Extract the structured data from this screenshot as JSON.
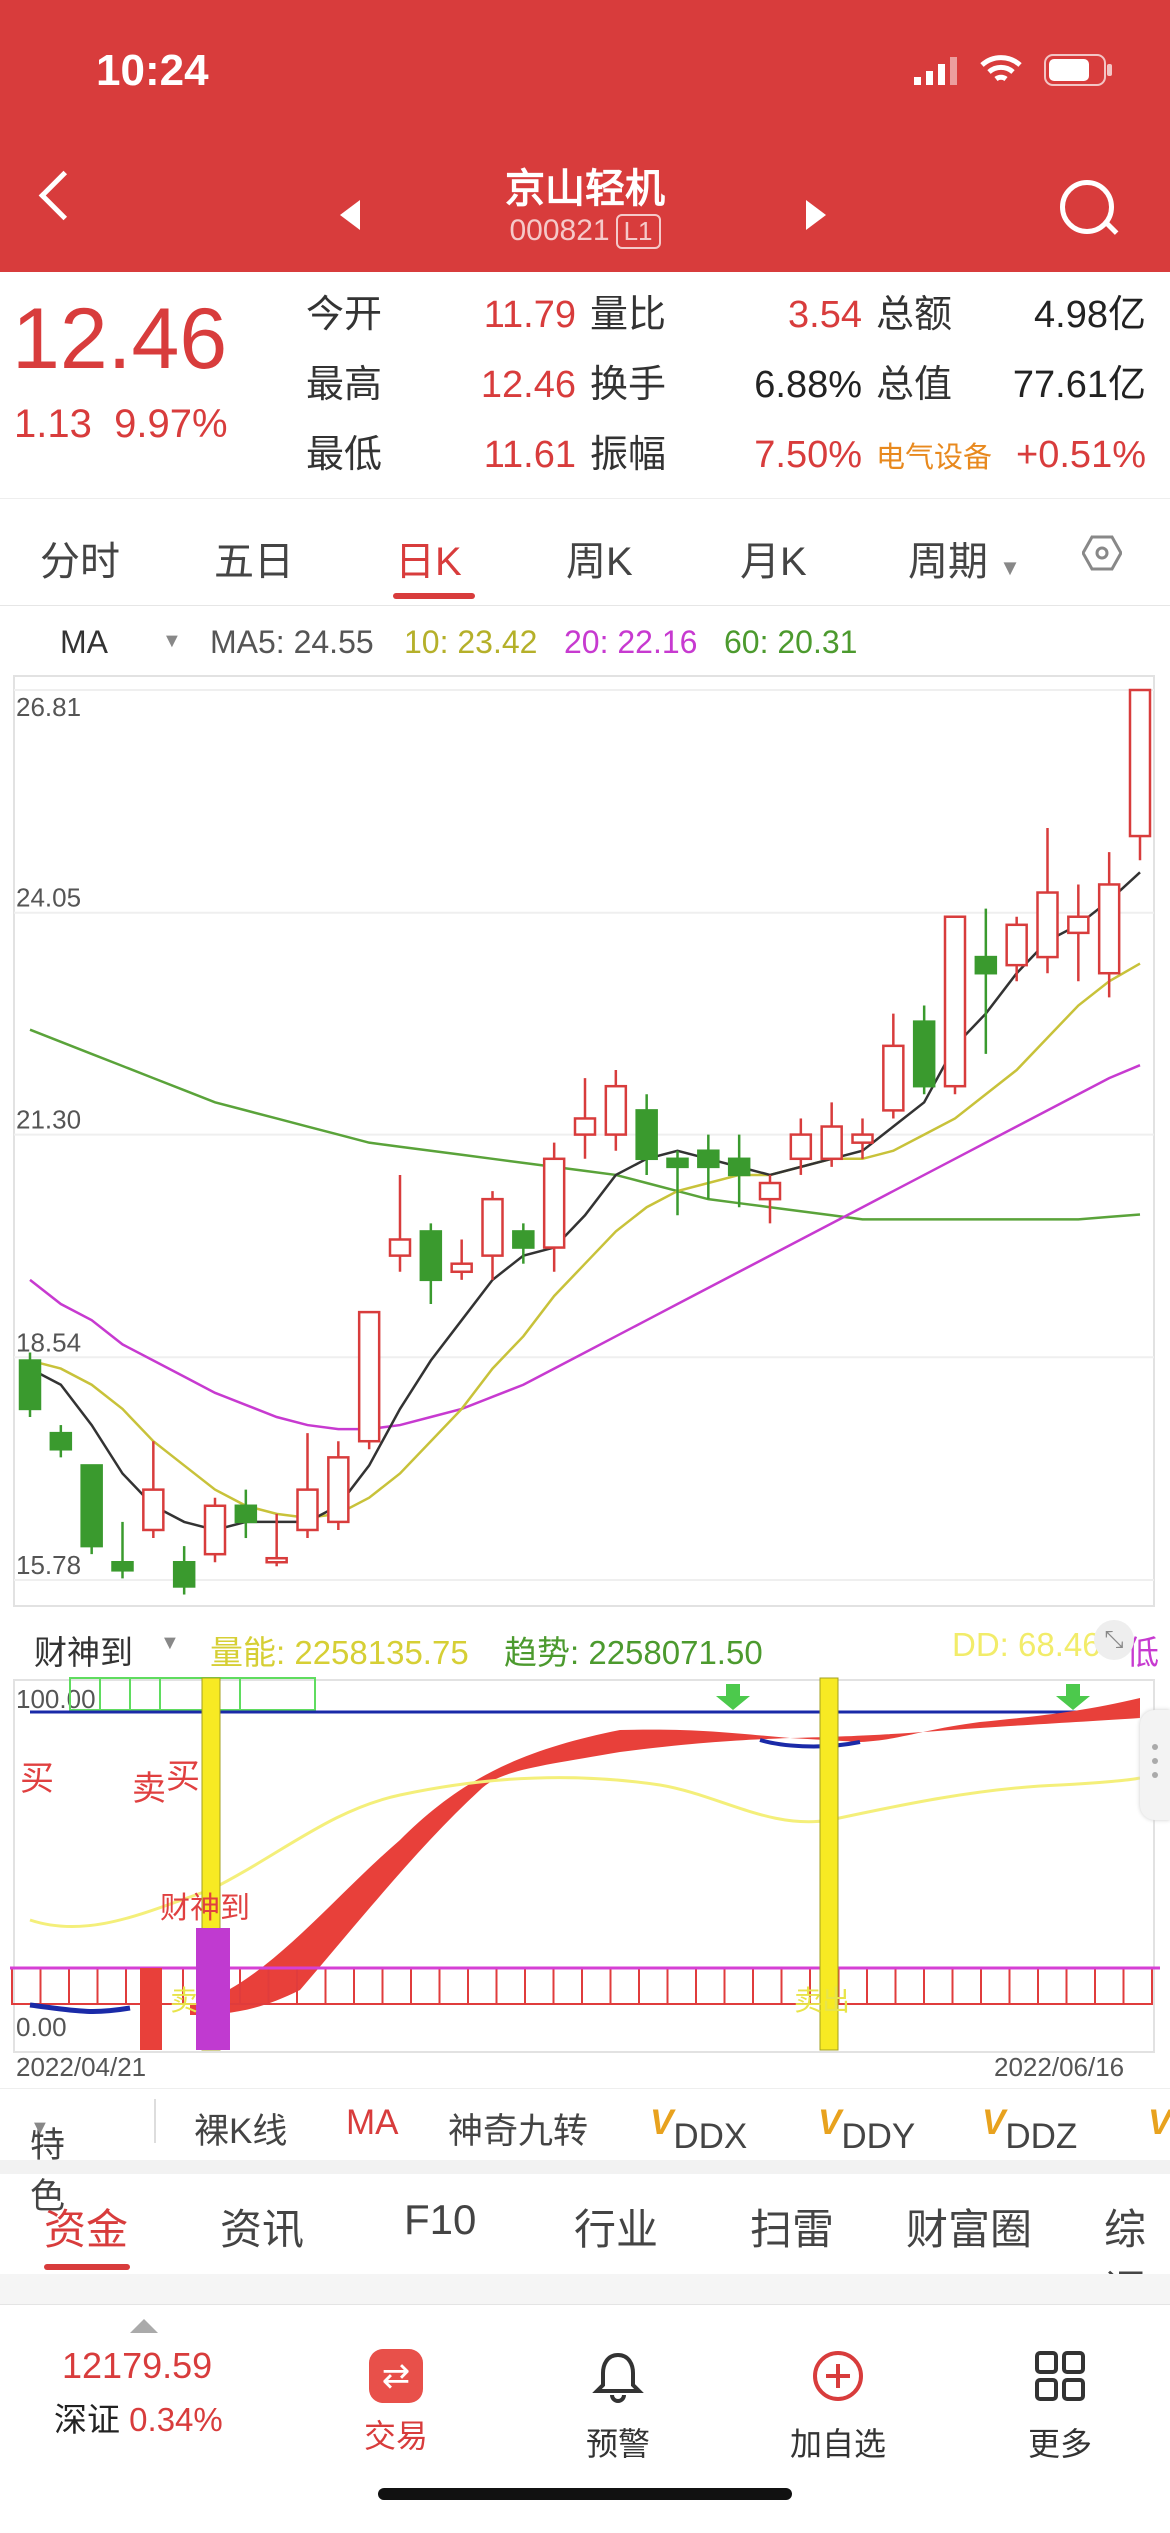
{
  "status": {
    "time": "10:24"
  },
  "header": {
    "title": "京山轻机",
    "code": "000821",
    "badge": "L1"
  },
  "quote": {
    "price": "12.46",
    "change": "1.13",
    "change_pct": "9.97%",
    "col1": [
      {
        "label": "今开",
        "value": "11.79"
      },
      {
        "label": "最高",
        "value": "12.46"
      },
      {
        "label": "最低",
        "value": "11.61"
      }
    ],
    "col2": [
      {
        "label": "量比",
        "value": "3.54"
      },
      {
        "label": "换手",
        "value": "6.88%"
      },
      {
        "label": "振幅",
        "value": "7.50%"
      }
    ],
    "col3": [
      {
        "label": "总额",
        "value": "4.98亿"
      },
      {
        "label": "总值",
        "value": "77.61亿"
      },
      {
        "label": "电气设备",
        "value": "+0.51%"
      }
    ]
  },
  "tabs": [
    "分时",
    "五日",
    "日K",
    "周K",
    "月K",
    "周期"
  ],
  "ma": {
    "name": "MA",
    "ma5": "MA5: 24.55",
    "ma10": "10: 23.42",
    "ma20": "20: 22.16",
    "ma60": "60: 20.31"
  },
  "indicator": {
    "name": "财神到",
    "vol": "量能: 2258135.75",
    "trend": "趋势: 2258071.50",
    "dd": "DD: 68.46",
    "extra": "低",
    "top_label": "100.00",
    "bottom_label": "0.00",
    "signal": "财神到",
    "left_text1": "买",
    "left_text2": "买",
    "left_text3": "卖",
    "bottom_text1": "卖",
    "bottom_text2": "卖出"
  },
  "dates": {
    "start": "2022/04/21",
    "end": "2022/06/16"
  },
  "tools": [
    "特色",
    "裸K线",
    "MA",
    "神奇九转",
    "DDX",
    "DDY",
    "DDZ"
  ],
  "ftabs": [
    "资金",
    "资讯",
    "F10",
    "行业",
    "扫雷",
    "财富圈",
    "综评"
  ],
  "bottom": {
    "index_value": "12179.59",
    "index_name": "深证",
    "index_pct": "0.34%",
    "trade": "交易",
    "alert": "预警",
    "add": "加自选",
    "more": "更多"
  },
  "colors": {
    "up": "#d83c3c",
    "down": "#3a9a2e",
    "ma5": "#333333",
    "ma10": "#c8c23a",
    "ma20": "#c73ad0",
    "ma60": "#5aa33a"
  },
  "chart_data": {
    "type": "candlestick",
    "y_ticks": [
      "26.81",
      "24.05",
      "21.30",
      "18.54",
      "15.78"
    ],
    "ylim": [
      15.78,
      26.81
    ],
    "candles": [
      {
        "o": 18.5,
        "c": 17.9,
        "h": 18.6,
        "l": 17.8
      },
      {
        "o": 17.6,
        "c": 17.4,
        "h": 17.7,
        "l": 17.3
      },
      {
        "o": 17.2,
        "c": 16.2,
        "h": 17.2,
        "l": 16.1
      },
      {
        "o": 16.0,
        "c": 15.9,
        "h": 16.5,
        "l": 15.8
      },
      {
        "o": 16.4,
        "c": 16.9,
        "h": 17.5,
        "l": 16.3
      },
      {
        "o": 16.0,
        "c": 15.7,
        "h": 16.2,
        "l": 15.6
      },
      {
        "o": 16.1,
        "c": 16.7,
        "h": 16.8,
        "l": 16.0
      },
      {
        "o": 16.7,
        "c": 16.5,
        "h": 16.9,
        "l": 16.3
      },
      {
        "o": 16.0,
        "c": 16.05,
        "h": 16.6,
        "l": 15.95
      },
      {
        "o": 16.4,
        "c": 16.9,
        "h": 17.6,
        "l": 16.3
      },
      {
        "o": 16.5,
        "c": 17.3,
        "h": 17.5,
        "l": 16.4
      },
      {
        "o": 17.5,
        "c": 19.1,
        "h": 19.1,
        "l": 17.4
      },
      {
        "o": 19.8,
        "c": 20.0,
        "h": 20.8,
        "l": 19.6
      },
      {
        "o": 20.1,
        "c": 19.5,
        "h": 20.2,
        "l": 19.2
      },
      {
        "o": 19.6,
        "c": 19.7,
        "h": 20.0,
        "l": 19.5
      },
      {
        "o": 19.8,
        "c": 20.5,
        "h": 20.6,
        "l": 19.5
      },
      {
        "o": 20.1,
        "c": 19.9,
        "h": 20.2,
        "l": 19.7
      },
      {
        "o": 19.9,
        "c": 21.0,
        "h": 21.2,
        "l": 19.6
      },
      {
        "o": 21.3,
        "c": 21.5,
        "h": 22.0,
        "l": 21.0
      },
      {
        "o": 21.3,
        "c": 21.9,
        "h": 22.1,
        "l": 21.1
      },
      {
        "o": 21.6,
        "c": 21.0,
        "h": 21.8,
        "l": 20.8
      },
      {
        "o": 21.0,
        "c": 20.9,
        "h": 21.1,
        "l": 20.3
      },
      {
        "o": 21.1,
        "c": 20.9,
        "h": 21.3,
        "l": 20.5
      },
      {
        "o": 21.0,
        "c": 20.8,
        "h": 21.3,
        "l": 20.4
      },
      {
        "o": 20.5,
        "c": 20.7,
        "h": 20.8,
        "l": 20.2
      },
      {
        "o": 21.0,
        "c": 21.3,
        "h": 21.5,
        "l": 20.8
      },
      {
        "o": 21.0,
        "c": 21.4,
        "h": 21.7,
        "l": 20.9
      },
      {
        "o": 21.2,
        "c": 21.3,
        "h": 21.5,
        "l": 21.0
      },
      {
        "o": 21.6,
        "c": 22.4,
        "h": 22.8,
        "l": 21.5
      },
      {
        "o": 22.7,
        "c": 21.9,
        "h": 22.9,
        "l": 21.8
      },
      {
        "o": 21.9,
        "c": 24.0,
        "h": 24.0,
        "l": 21.8
      },
      {
        "o": 23.5,
        "c": 23.3,
        "h": 24.1,
        "l": 22.3
      },
      {
        "o": 23.4,
        "c": 23.9,
        "h": 24.0,
        "l": 23.2
      },
      {
        "o": 23.5,
        "c": 24.3,
        "h": 25.1,
        "l": 23.3
      },
      {
        "o": 23.8,
        "c": 24.0,
        "h": 24.4,
        "l": 23.2
      },
      {
        "o": 23.3,
        "c": 24.4,
        "h": 24.8,
        "l": 23.0
      },
      {
        "o": 25.0,
        "c": 26.81,
        "h": 26.81,
        "l": 24.7
      }
    ],
    "ma5": [
      18.4,
      18.2,
      17.7,
      17.1,
      16.7,
      16.5,
      16.4,
      16.5,
      16.5,
      16.5,
      16.7,
      17.2,
      17.9,
      18.5,
      19.0,
      19.5,
      19.8,
      19.9,
      20.3,
      20.8,
      21.0,
      21.1,
      21.0,
      20.9,
      20.8,
      20.9,
      21.0,
      21.1,
      21.4,
      21.7,
      22.4,
      22.8,
      23.3,
      23.7,
      23.9,
      24.2,
      24.55
    ],
    "ma10": [
      18.5,
      18.4,
      18.2,
      17.9,
      17.5,
      17.2,
      16.9,
      16.7,
      16.6,
      16.55,
      16.6,
      16.8,
      17.1,
      17.5,
      17.9,
      18.4,
      18.8,
      19.3,
      19.7,
      20.1,
      20.4,
      20.6,
      20.7,
      20.8,
      20.8,
      20.9,
      21.0,
      21.0,
      21.1,
      21.3,
      21.5,
      21.8,
      22.1,
      22.5,
      22.9,
      23.2,
      23.42
    ],
    "ma20": [
      19.5,
      19.2,
      19.0,
      18.7,
      18.5,
      18.3,
      18.1,
      17.95,
      17.8,
      17.7,
      17.65,
      17.65,
      17.7,
      17.8,
      17.9,
      18.05,
      18.2,
      18.4,
      18.6,
      18.8,
      19.0,
      19.2,
      19.4,
      19.6,
      19.8,
      20.0,
      20.2,
      20.4,
      20.6,
      20.8,
      21.0,
      21.2,
      21.4,
      21.6,
      21.8,
      22.0,
      22.16
    ],
    "ma60": [
      22.6,
      22.45,
      22.3,
      22.15,
      22.0,
      21.85,
      21.7,
      21.6,
      21.5,
      21.4,
      21.3,
      21.2,
      21.15,
      21.1,
      21.05,
      21.0,
      20.95,
      20.9,
      20.85,
      20.8,
      20.7,
      20.6,
      20.5,
      20.45,
      20.4,
      20.35,
      20.3,
      20.25,
      20.25,
      20.25,
      20.25,
      20.25,
      20.25,
      20.25,
      20.25,
      20.28,
      20.31
    ]
  }
}
